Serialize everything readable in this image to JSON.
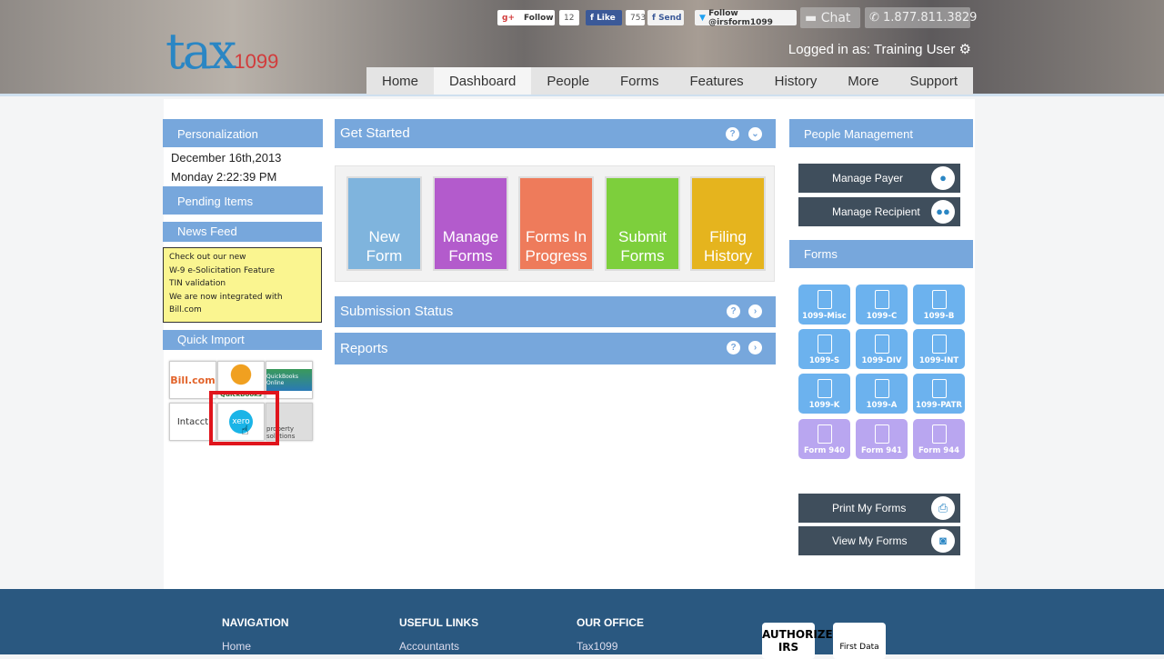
{
  "header": {
    "logo_main": "tax",
    "logo_num": "1099",
    "gplus_follow": "Follow",
    "gplus_count": "12",
    "fb_like": "Like",
    "fb_count": "753",
    "fb_send": "Send",
    "twitter": "Follow @irsform1099",
    "chat": "Chat",
    "phone": "1.877.811.3829",
    "logged_in": "Logged in as: Training User"
  },
  "nav": [
    "Home",
    "Dashboard",
    "People",
    "Forms",
    "Features",
    "History",
    "More",
    "Support"
  ],
  "left": {
    "personalization": "Personalization",
    "date": "December 16th,2013",
    "time": "Monday 2:22:39 PM",
    "pending": "Pending Items",
    "newsfeed": "News Feed",
    "news": [
      "Check out our new",
      "W-9 e-Solicitation Feature",
      "TIN validation",
      "We are now integrated with Bill.com"
    ],
    "quick_import": "Quick Import",
    "imports": [
      "Bill.com",
      "QuickBooks",
      "QuickBooks Online",
      "Intacct",
      "xero",
      "property solutions"
    ]
  },
  "center": {
    "get_started": "Get Started",
    "tiles": [
      {
        "l1": "New",
        "l2": "Form",
        "color": "#7fb4dd"
      },
      {
        "l1": "Manage",
        "l2": "Forms",
        "color": "#b35bcc"
      },
      {
        "l1": "Forms In",
        "l2": "Progress",
        "color": "#ee7b5b"
      },
      {
        "l1": "Submit",
        "l2": "Forms",
        "color": "#7dcf3c"
      },
      {
        "l1": "Filing",
        "l2": "History",
        "color": "#e5b41e"
      }
    ],
    "submission": "Submission Status",
    "reports": "Reports"
  },
  "right": {
    "people_mgmt": "People Management",
    "manage_payer": "Manage Payer",
    "manage_recipient": "Manage Recipient",
    "forms": "Forms",
    "form_list": [
      "1099-Misc",
      "1099-C",
      "1099-B",
      "1099-S",
      "1099-DIV",
      "1099-INT",
      "1099-K",
      "1099-A",
      "1099-PATR",
      "Form 940",
      "Form 941",
      "Form 944"
    ],
    "print": "Print My Forms",
    "view": "View My Forms"
  },
  "footer": {
    "navigation": "NAVIGATION",
    "nav_home": "Home",
    "useful": "USEFUL LINKS",
    "accountants": "Accountants",
    "office": "OUR OFFICE",
    "office_name": "Tax1099",
    "irs_badge": "AUTHORIZED IRS",
    "firstdata": "First Data"
  }
}
